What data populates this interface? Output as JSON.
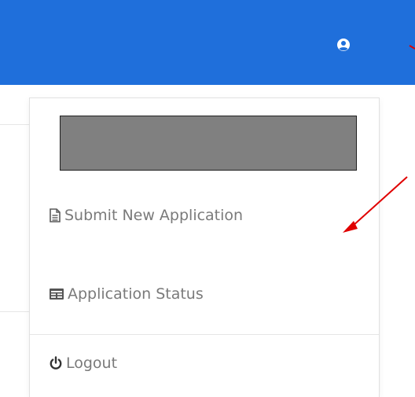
{
  "header": {
    "user_icon": "user-circle-icon",
    "accent_color": "#1f6fdb"
  },
  "dropdown": {
    "items": [
      {
        "label": "Submit New Application",
        "icon": "document-icon"
      },
      {
        "label": "Application Status",
        "icon": "card-icon"
      }
    ],
    "logout": {
      "label": "Logout",
      "icon": "power-icon"
    }
  },
  "annotation_color": "#e00000"
}
